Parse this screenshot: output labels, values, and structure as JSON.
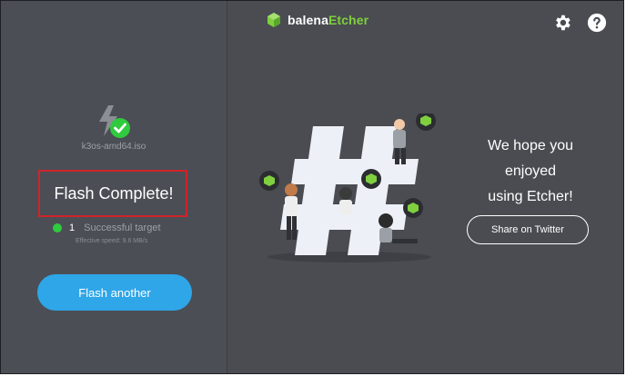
{
  "app": {
    "logo_prefix": "balena",
    "logo_suffix": "Etcher",
    "settings_icon": "gear-icon",
    "help_icon": "question-icon"
  },
  "left": {
    "file_name": "k3os-amd64.iso",
    "status_title": "Flash Complete!",
    "target_count": "1",
    "target_label": "Successful target",
    "effective_speed": "Effective speed: 9.6 MB/s",
    "flash_another_label": "Flash another"
  },
  "right": {
    "hope_line1": "We hope you",
    "hope_line2": "enjoyed",
    "hope_line3": "using Etcher!",
    "share_label": "Share on Twitter"
  },
  "colors": {
    "accent_green": "#7fcf3f",
    "button_blue": "#2ea6e8",
    "success_green": "#2fca3d",
    "highlight_red": "#d2232a"
  }
}
